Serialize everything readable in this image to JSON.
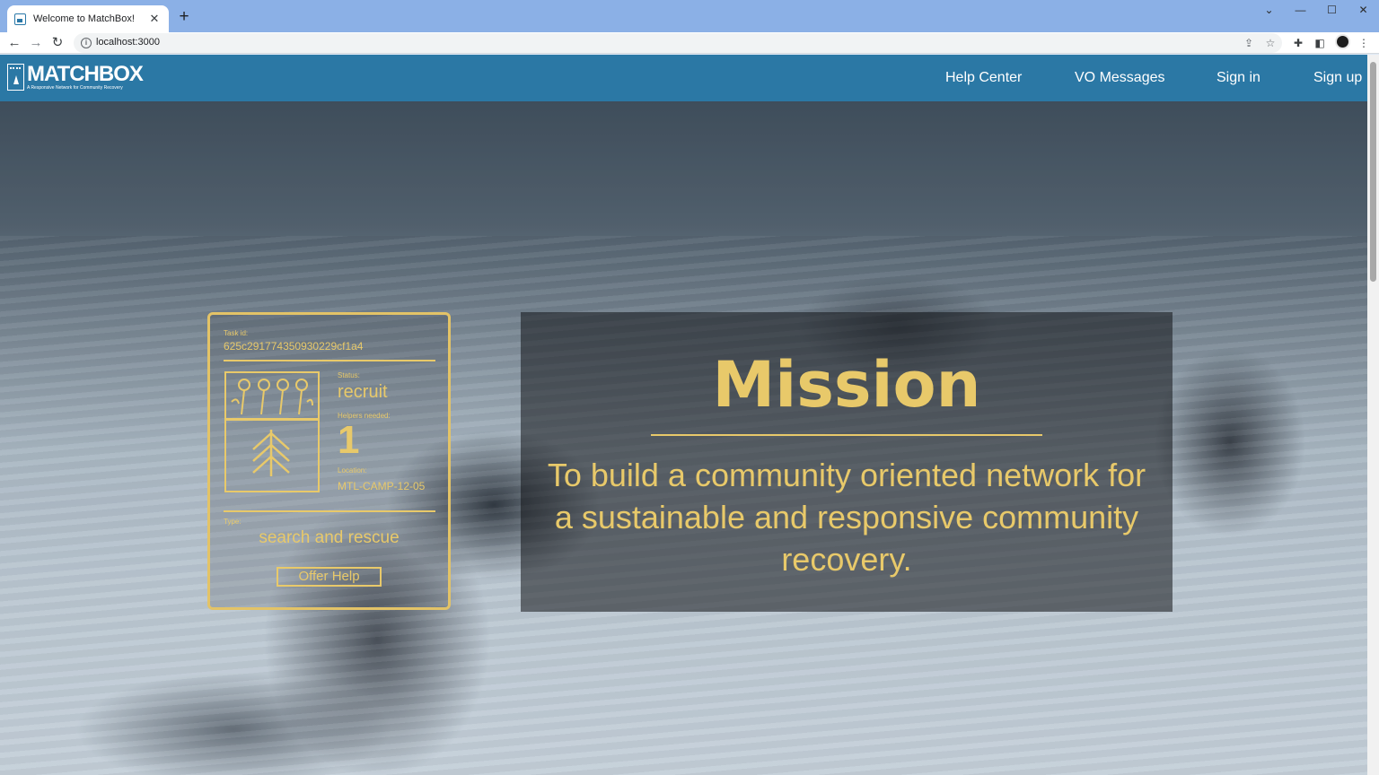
{
  "browser": {
    "tab": {
      "title": "Welcome to MatchBox!",
      "close": "✕"
    },
    "new_tab": "+",
    "url": "localhost:3000",
    "window_controls": [
      "⌄",
      "—",
      "☐",
      "✕"
    ],
    "nav_icons": {
      "back": "←",
      "forward": "→",
      "reload": "↻",
      "info": "i"
    },
    "toolbar_icons": [
      "share-icon",
      "star-icon",
      "puzzle-icon",
      "sidebar-icon",
      "profile-icon",
      "menu-icon"
    ]
  },
  "site": {
    "logo": {
      "name": "MATCHBOX",
      "tagline": "A Responsive Network for Community Recovery"
    },
    "nav": [
      "Help Center",
      "VO Messages",
      "Sign in",
      "Sign up"
    ],
    "brand_color": "#2b78a5",
    "accent_color": "#e8c96a"
  },
  "task_card": {
    "task_id_label": "Task id:",
    "task_id": "625c291774350930229cf1a4",
    "status_label": "Status:",
    "status": "recruit",
    "helpers_label": "Helpers needed:",
    "helpers": "1",
    "location_label": "Location:",
    "location": "MTL-CAMP-12-05",
    "type_label": "Type:",
    "type": "search and rescue",
    "button": "Offer Help"
  },
  "mission": {
    "title": "Mission",
    "body": "To build a community oriented network for a sustainable and responsive community recovery."
  }
}
